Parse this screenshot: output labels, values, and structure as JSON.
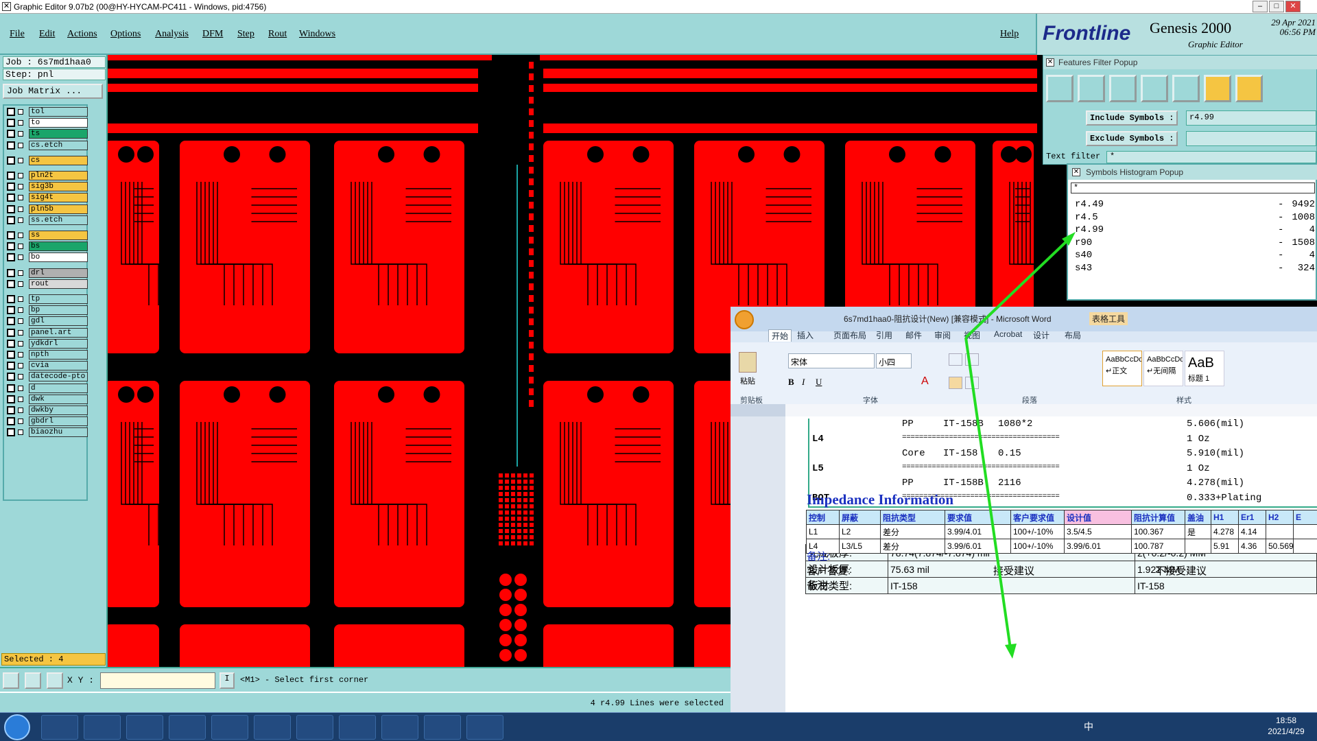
{
  "window": {
    "title": "Graphic Editor 9.07b2 (00@HY-HYCAM-PC411 - Windows, pid:4756)"
  },
  "menu": [
    "File",
    "Edit",
    "Actions",
    "Options",
    "Analysis",
    "DFM",
    "Step",
    "Rout",
    "Windows"
  ],
  "help_label": "Help",
  "logo": {
    "brand": "Frontline",
    "product": "Genesis 2000",
    "subtitle": "Graphic Editor",
    "date": "29 Apr 2021",
    "time": "06:56 PM"
  },
  "info": {
    "job": "Job : 6s7md1haa0",
    "step": "Step: pnl",
    "job_matrix": "Job Matrix ..."
  },
  "layers": [
    {
      "name": "tol",
      "color": "#9ed8d8"
    },
    {
      "name": "to",
      "color": "#ffffff"
    },
    {
      "name": "ts",
      "color": "#1aa56a"
    },
    {
      "name": "cs.etch",
      "color": "#9ed8d8"
    },
    {
      "name": "cs",
      "color": "#f5c542"
    },
    {
      "name": "pln2t",
      "color": "#f5c542"
    },
    {
      "name": "sig3b",
      "color": "#f5c542"
    },
    {
      "name": "sig4t",
      "color": "#f5c542"
    },
    {
      "name": "pln5b",
      "color": "#f5c542"
    },
    {
      "name": "ss.etch",
      "color": "#9ed8d8"
    },
    {
      "name": "ss",
      "color": "#f5c542"
    },
    {
      "name": "bs",
      "color": "#1aa56a"
    },
    {
      "name": "bo",
      "color": "#ffffff"
    },
    {
      "name": "drl",
      "color": "#b0b0b0"
    },
    {
      "name": "rout",
      "color": "#d8d8d8"
    },
    {
      "name": "tp",
      "color": "#9ed8d8"
    },
    {
      "name": "bp",
      "color": "#9ed8d8"
    },
    {
      "name": "gdl",
      "color": "#9ed8d8"
    },
    {
      "name": "panel.art",
      "color": "#9ed8d8"
    },
    {
      "name": "ydkdrl",
      "color": "#9ed8d8"
    },
    {
      "name": "npth",
      "color": "#9ed8d8"
    },
    {
      "name": "cvia",
      "color": "#9ed8d8"
    },
    {
      "name": "datecode-pto",
      "color": "#9ed8d8"
    },
    {
      "name": "d",
      "color": "#9ed8d8"
    },
    {
      "name": "dwk",
      "color": "#9ed8d8"
    },
    {
      "name": "dwkby",
      "color": "#9ed8d8"
    },
    {
      "name": "gbdrl",
      "color": "#9ed8d8"
    },
    {
      "name": "biaozhu",
      "color": "#9ed8d8"
    }
  ],
  "selected": "Selected : 4",
  "bottom": {
    "xy_label": "X Y :",
    "prompt": "<M1> - Select first corner",
    "status": "4 r4.99 Lines were selected"
  },
  "features_filter": {
    "title": "Features Filter Popup",
    "include_label": "Include Symbols :",
    "include_value": "r4.99",
    "exclude_label": "Exclude Symbols :",
    "text_filter": "Text filter",
    "text_value": "*"
  },
  "histogram": {
    "title": "Symbols Histogram Popup",
    "filter": "*",
    "rows": [
      {
        "sym": "r4.49",
        "count": "9492"
      },
      {
        "sym": "r4.5",
        "count": "1008"
      },
      {
        "sym": "r4.99",
        "count": "4"
      },
      {
        "sym": "r90",
        "count": "1508"
      },
      {
        "sym": "s40",
        "count": "4"
      },
      {
        "sym": "s43",
        "count": "324"
      }
    ]
  },
  "word": {
    "title": "6s7md1haa0-阻抗设计(New) [兼容模式] - Microsoft Word",
    "table_tools": "表格工具",
    "tabs": [
      "开始",
      "插入",
      "页面布局",
      "引用",
      "邮件",
      "审阅",
      "视图",
      "Acrobat",
      "设计",
      "布局"
    ],
    "font": "宋体",
    "size": "小四",
    "styles": [
      "AaBbCcDd",
      "AaBbCcDd",
      "AaB"
    ],
    "style_names": [
      "↵正文",
      "↵无间隔",
      "标题 1"
    ],
    "groups": [
      "剪贴板",
      "字体",
      "段落",
      "样式"
    ],
    "paste": "粘贴",
    "stack": [
      {
        "layer": "",
        "mat": "PP",
        "type": "IT-158B",
        "spec": "1080*2",
        "thick": "5.606(mil)"
      },
      {
        "layer": "L4",
        "mat": "=====================================",
        "type": "",
        "spec": "",
        "thick": "1 Oz"
      },
      {
        "layer": "",
        "mat": "Core",
        "type": "IT-158",
        "spec": "0.15",
        "thick": "5.910(mil)"
      },
      {
        "layer": "L5",
        "mat": "=====================================",
        "type": "",
        "spec": "",
        "thick": "1 Oz"
      },
      {
        "layer": "",
        "mat": "PP",
        "type": "IT-158B",
        "spec": "2116",
        "thick": "4.278(mil)"
      },
      {
        "layer": "BOT",
        "mat": "=====================================",
        "type": "",
        "spec": "",
        "thick": "0.333+Plating"
      }
    ],
    "board": [
      {
        "k": "完成板厚:",
        "v": "78.74(7.874/-7.874) mil",
        "v2": "2(+0.2/-0.2) MM"
      },
      {
        "k": "设计板厚:",
        "v": "75.63 mil",
        "v2": "1.921 MM"
      },
      {
        "k": "板材类型:",
        "v": "IT-158",
        "v2": "IT-158"
      }
    ],
    "impedance_title": "Impedance Information",
    "imp_headers": [
      "控制",
      "屏蔽",
      "阻抗类型",
      "要求值",
      "客户要求值",
      "设计值",
      "阻抗计算值",
      "盖油",
      "H1",
      "Er1",
      "H2",
      "E"
    ],
    "imp_rows": [
      [
        "L1",
        "L2",
        "差分",
        "3.99/4.01",
        "100+/-10%",
        "3.5/4.5",
        "100.367",
        "是",
        "4.278",
        "4.14",
        "",
        ""
      ],
      [
        "L4",
        "L3/L5",
        "差分",
        "3.99/6.01",
        "100+/-10%",
        "3.99/6.01",
        "100.787",
        "",
        "5.91",
        "4.36",
        "50.569",
        ""
      ]
    ],
    "notes1": "备注:",
    "reply": "客户答复:",
    "accept": "接受建议",
    "reject": "不接受建议",
    "notes2": "备注:"
  },
  "tray": {
    "ime": "中",
    "time": "18:58",
    "date": "2021/4/29"
  },
  "colors": {
    "pcb_copper": "#ff0000",
    "pcb_bg": "#000000",
    "panel_bg": "#9ed8d8",
    "arrow": "#22dd22"
  }
}
